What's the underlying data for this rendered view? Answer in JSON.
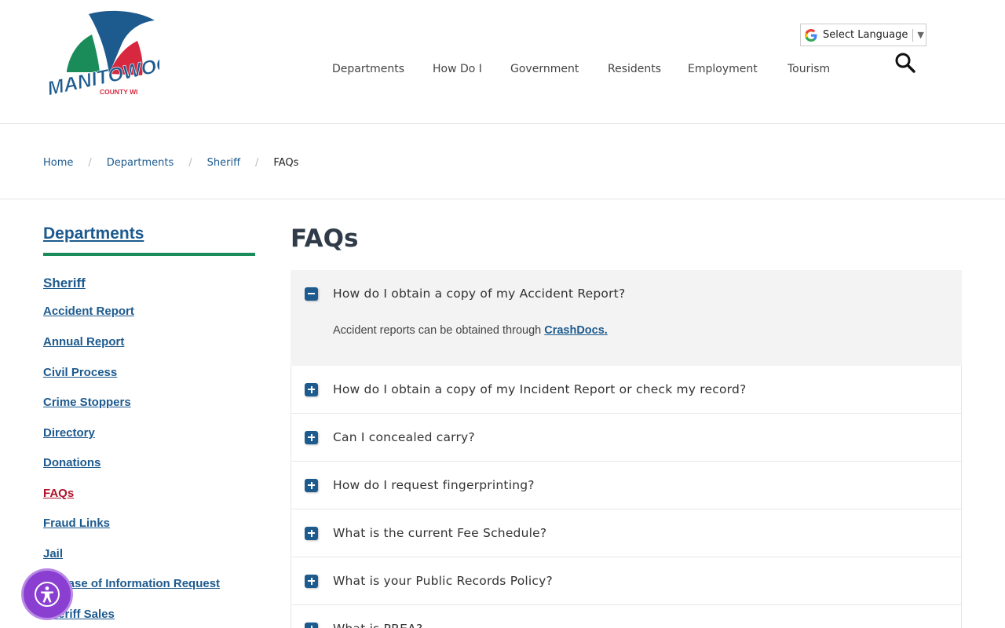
{
  "header": {
    "logo": {
      "name": "MANITOWOC",
      "sub": "COUNTY WI",
      "colors": {
        "blue": "#1d5a8e",
        "green": "#1a8c5a",
        "red": "#d8283f"
      }
    },
    "language": {
      "label": "Select Language",
      "icon": "google-g-icon",
      "caret": "▼"
    },
    "nav": [
      "Departments",
      "How Do I",
      "Government",
      "Residents",
      "Employment",
      "Tourism"
    ],
    "search_icon": "search-icon"
  },
  "breadcrumb": {
    "items": [
      "Home",
      "Departments",
      "Sheriff"
    ],
    "separator": "/",
    "current": "FAQs"
  },
  "sidebar": {
    "title": "Departments",
    "section": "Sheriff",
    "links": [
      "Accident Report",
      "Annual Report",
      "Civil Process",
      "Crime Stoppers",
      "Directory",
      "Donations",
      "FAQs",
      "Fraud Links",
      "Jail",
      "Release of Information Request",
      "Sheriff Sales"
    ],
    "active": "FAQs"
  },
  "main": {
    "title": "FAQs",
    "faqs": [
      {
        "question": "How do I obtain a copy of my Accident Report?",
        "open": true,
        "answer_text": "Accident reports can be obtained through ",
        "answer_link": "CrashDocs."
      },
      {
        "question": "How do I obtain a copy of my Incident Report or check my record?",
        "open": false
      },
      {
        "question": "Can I concealed carry?",
        "open": false
      },
      {
        "question": "How do I request fingerprinting?",
        "open": false
      },
      {
        "question": "What is the current Fee Schedule?",
        "open": false
      },
      {
        "question": "What is your Public Records Policy?",
        "open": false
      },
      {
        "question": "What is PREA?",
        "open": false
      }
    ]
  },
  "accessibility": {
    "icon": "accessibility-icon",
    "color": "#8a3fd1"
  }
}
